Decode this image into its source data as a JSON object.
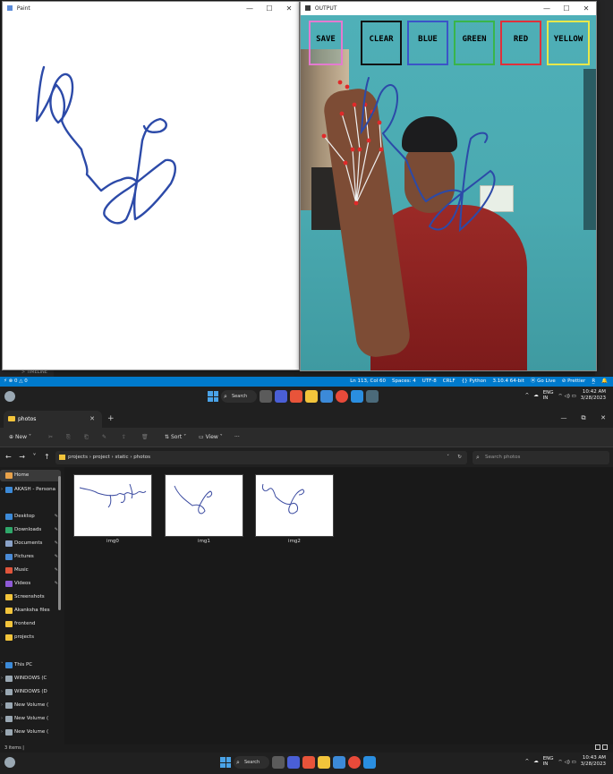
{
  "paint_window": {
    "title": "Paint",
    "controls": [
      "—",
      "☐",
      "✕"
    ]
  },
  "output_window": {
    "title": "OUTPUT",
    "controls": [
      "—",
      "☐",
      "✕"
    ],
    "buttons": [
      {
        "label": "SAVE",
        "color": "#e47ad0"
      },
      {
        "label": "CLEAR",
        "color": "#111111"
      },
      {
        "label": "BLUE",
        "color": "#3b54c8"
      },
      {
        "label": "GREEN",
        "color": "#39b54a"
      },
      {
        "label": "RED",
        "color": "#e0303a"
      },
      {
        "label": "YELLOW",
        "color": "#e8e84a"
      }
    ]
  },
  "vscode": {
    "outline_label": "> TIMELINE",
    "status_left": "⚡ ⊗ 0 △ 0",
    "status_right": [
      "Ln 113, Col 60",
      "Spaces: 4",
      "UTF-8",
      "CRLF",
      "{} Python",
      "3.10.4 64-bit",
      "⦿ Go Live",
      "⊘ Prettier",
      "R̲",
      "🔔"
    ]
  },
  "taskbar_top": {
    "search": "Search",
    "lang": "ENG",
    "region": "IN",
    "time": "10:42 AM",
    "date": "3/28/2023"
  },
  "explorer": {
    "tab_title": "photos",
    "toolbar": {
      "new": "New",
      "sort": "Sort",
      "view": "View",
      "more": "···"
    },
    "path": [
      "projects",
      "project",
      "static",
      "photos"
    ],
    "search_placeholder": "Search photos",
    "sidebar": {
      "home": "Home",
      "onedrive": "AKASH - Persona",
      "quick": [
        {
          "label": "Desktop",
          "color": "#3c8ad8"
        },
        {
          "label": "Downloads",
          "color": "#2fa86a"
        },
        {
          "label": "Documents",
          "color": "#8aa2c8"
        },
        {
          "label": "Pictures",
          "color": "#4a8bd6"
        },
        {
          "label": "Music",
          "color": "#e0553b"
        },
        {
          "label": "Videos",
          "color": "#8e5ad6"
        },
        {
          "label": "Screenshots",
          "color": "#f2c43b"
        },
        {
          "label": "Akanksha files",
          "color": "#f2c43b"
        },
        {
          "label": "frontend",
          "color": "#f2c43b"
        },
        {
          "label": "projects",
          "color": "#f2c43b"
        }
      ],
      "this_pc": "This PC",
      "drives": [
        "WINDOWS (C",
        "WINDOWS (D",
        "New Volume (",
        "New Volume (",
        "New Volume ("
      ]
    },
    "files": [
      {
        "name": "img0"
      },
      {
        "name": "img1"
      },
      {
        "name": "img2"
      }
    ],
    "status": "3 items  |"
  },
  "taskbar_bottom": {
    "search": "Search",
    "lang": "ENG",
    "region": "IN",
    "time": "10:43 AM",
    "date": "3/28/2023"
  }
}
